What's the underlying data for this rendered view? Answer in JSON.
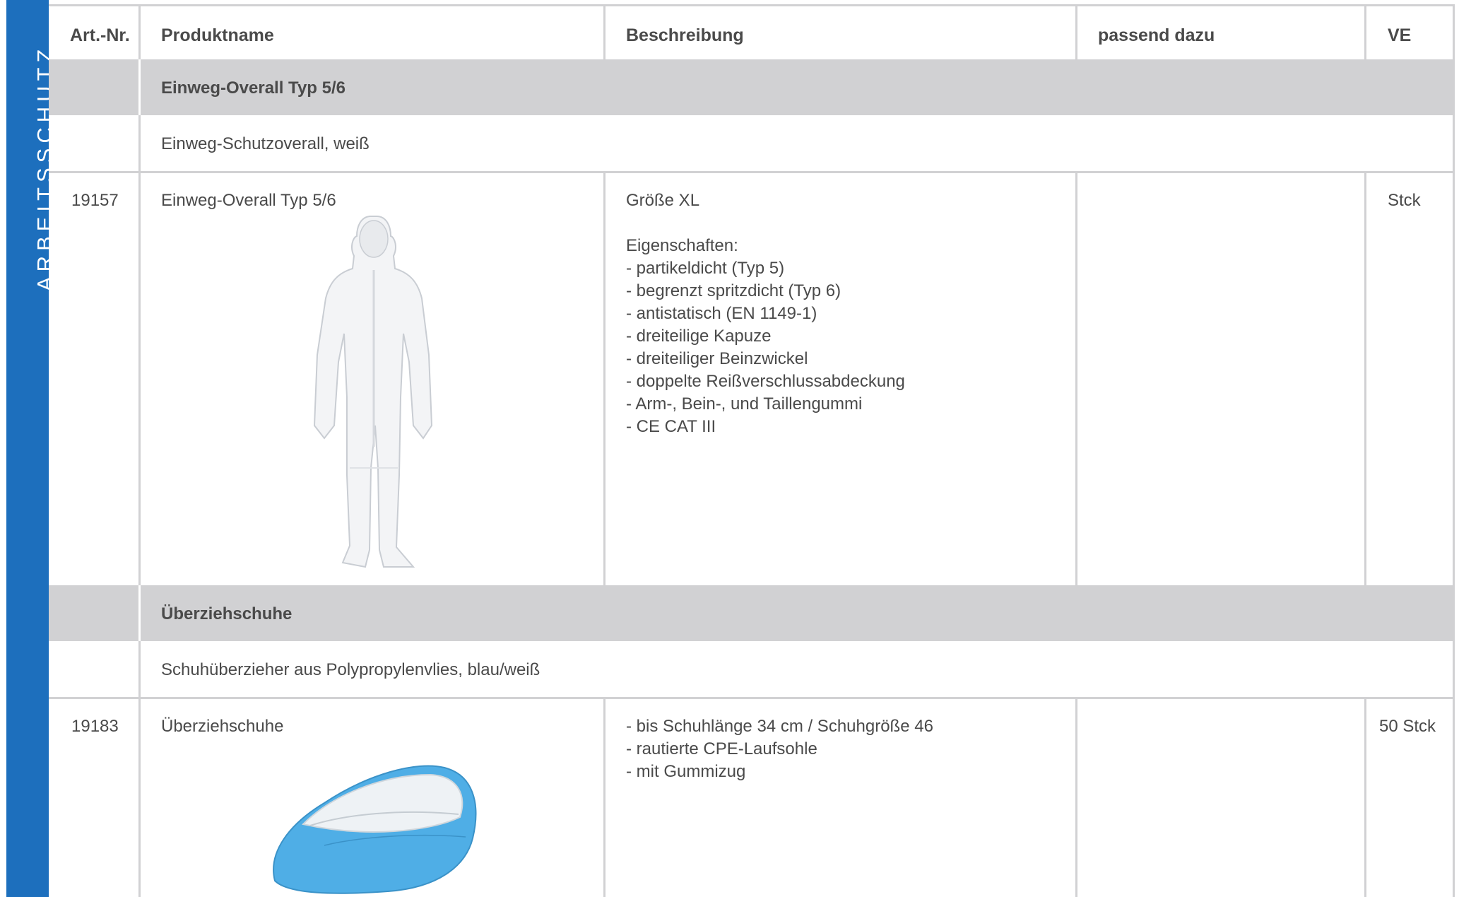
{
  "side_tab": {
    "label": "ARBEITSSCHUTZ"
  },
  "header": {
    "art_nr": "Art.-Nr.",
    "produktname": "Produktname",
    "beschreibung": "Beschreibung",
    "passend_dazu": "passend dazu",
    "ve": "VE"
  },
  "sections": [
    {
      "title": "Einweg-Overall Typ 5/6",
      "subtitle": "Einweg-Schutzoverall, weiß",
      "product": {
        "art_nr": "19157",
        "name": "Einweg-Overall Typ 5/6",
        "description": [
          "Größe XL",
          "",
          "Eigenschaften:",
          "- partikeldicht (Typ 5)",
          "- begrenzt spritzdicht (Typ 6)",
          "- antistatisch (EN 1149-1)",
          "- dreiteilige Kapuze",
          "- dreiteiliger Beinzwickel",
          "- doppelte Reißverschlussabdeckung",
          "- Arm-, Bein-, und Taillengummi",
          "- CE CAT III"
        ],
        "passend_dazu": "",
        "ve": "Stck"
      }
    },
    {
      "title": "Überziehschuhe",
      "subtitle": "Schuhüberzieher aus Polypropylenvlies, blau/weiß",
      "product": {
        "art_nr": "19183",
        "name": "Überziehschuhe",
        "description": [
          "- bis Schuhlänge 34 cm / Schuhgröße 46",
          "- rautierte CPE-Laufsohle",
          "- mit Gummizug"
        ],
        "passend_dazu": "",
        "ve": "50 Stck"
      }
    }
  ]
}
